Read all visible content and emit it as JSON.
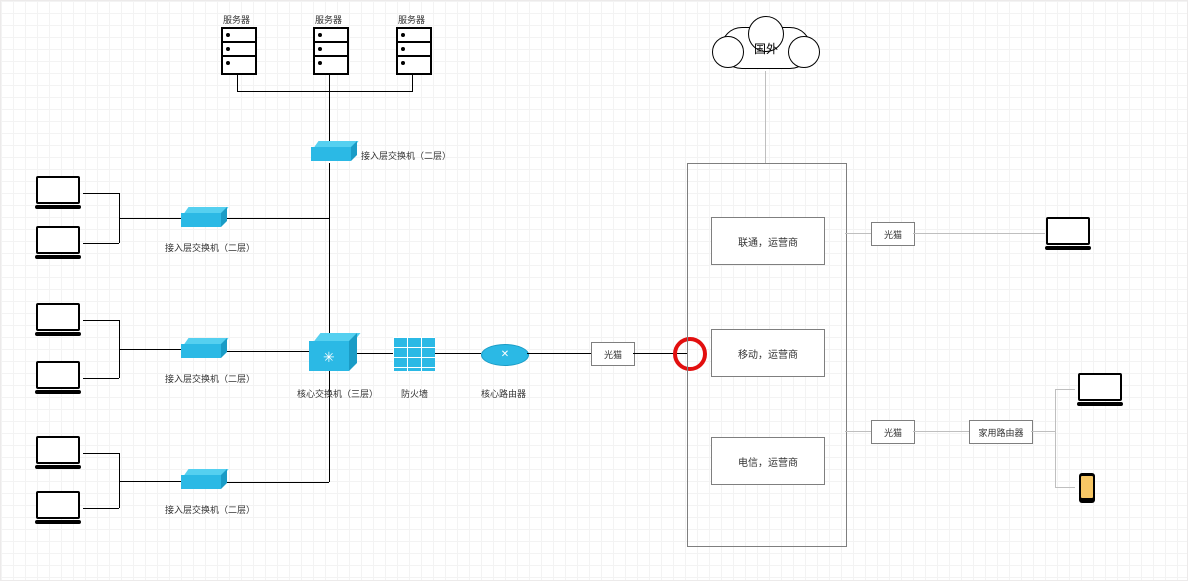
{
  "servers": {
    "label": "服务器"
  },
  "access_switch_l2": "接入层交换机（二层）",
  "core_switch_l3": "核心交换机（三层）",
  "firewall": "防火墙",
  "core_router": "核心路由器",
  "cloud": "国外",
  "carriers": {
    "unicom": "联通，运营商",
    "mobile": "移动，运营商",
    "telecom": "电信，运营商"
  },
  "optical_modem": "光猫",
  "home_router": "家用路由器"
}
